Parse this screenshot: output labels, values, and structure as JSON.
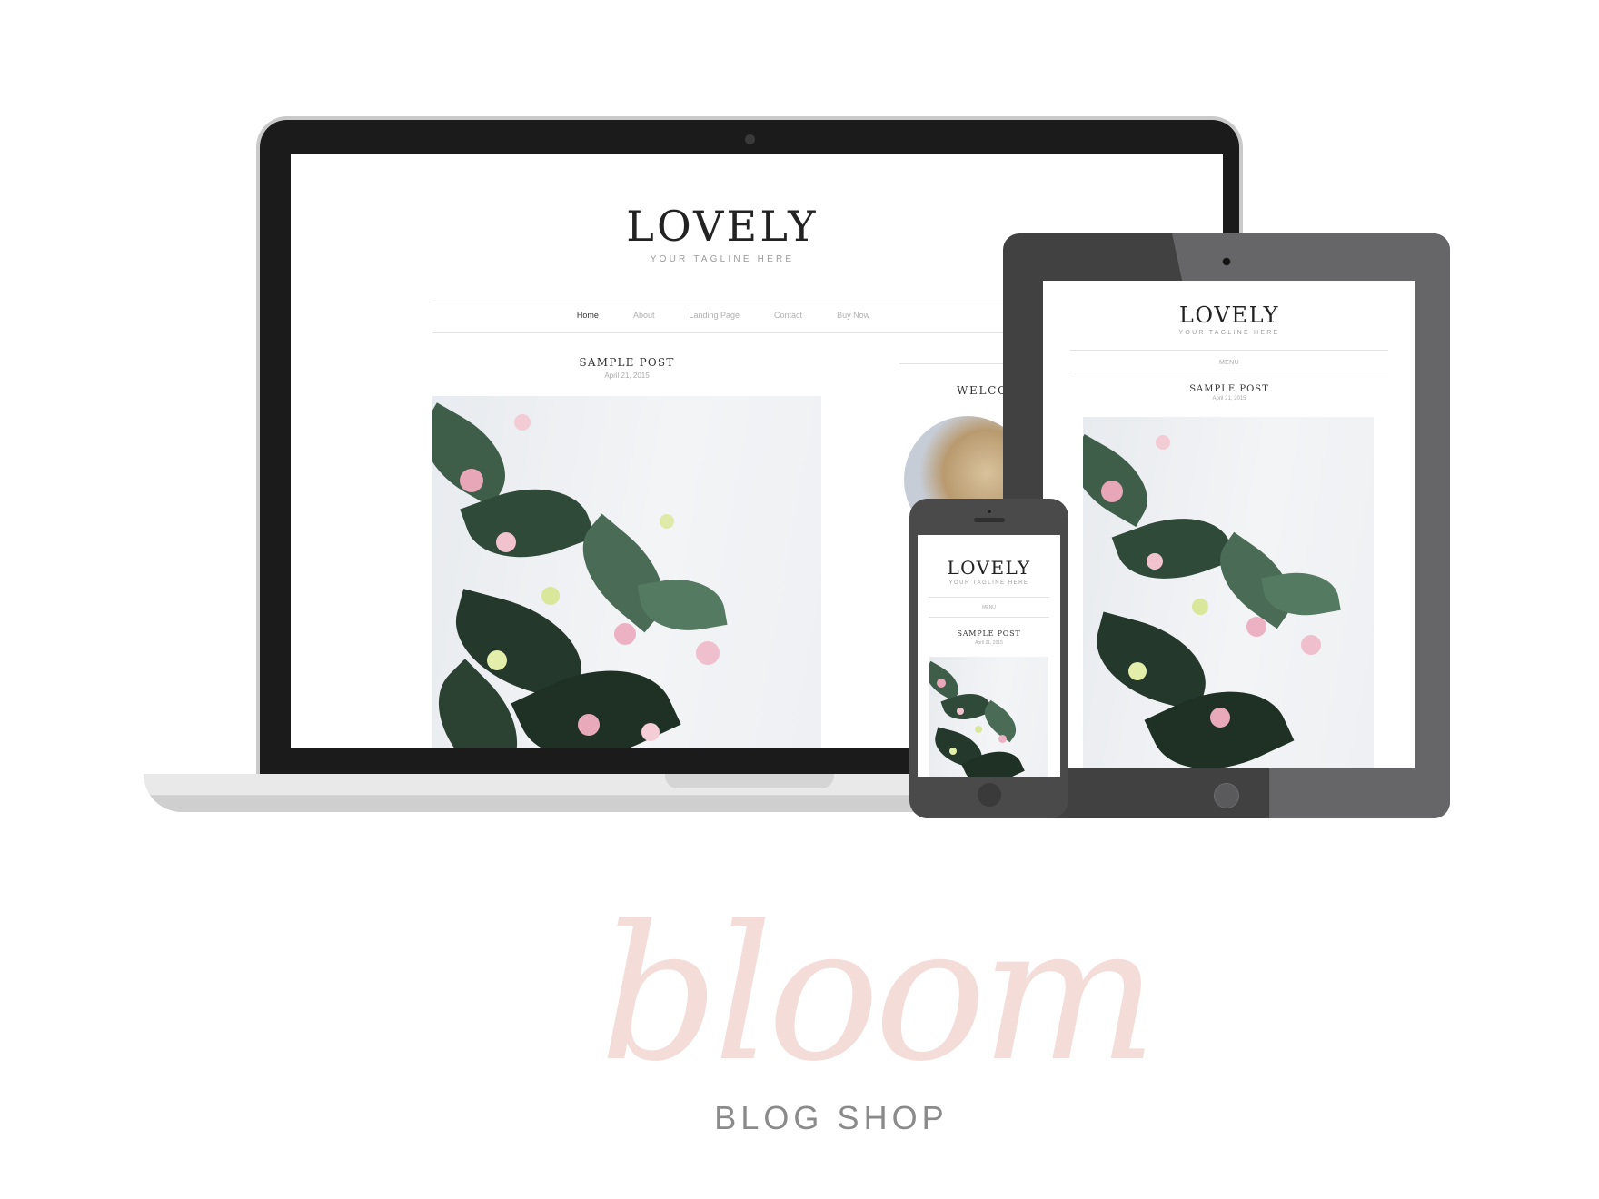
{
  "site": {
    "title": "LOVELY",
    "tagline": "YOUR TAGLINE HERE",
    "nav": [
      "Home",
      "About",
      "Landing Page",
      "Contact",
      "Buy Now"
    ],
    "mobile_menu_label": "MENU",
    "post_title": "SAMPLE POST",
    "post_date": "April 21, 2015",
    "sidebar_heading": "WELCO"
  },
  "brand": {
    "script": "bloom",
    "subtitle": "BLOG SHOP"
  },
  "colors": {
    "device_dark": "#1b1b1c",
    "tablet_body": "#414142",
    "phone_body": "#4a4a4b",
    "brand_pink": "#f4dcd8",
    "brand_gray": "#8a8a8a"
  }
}
